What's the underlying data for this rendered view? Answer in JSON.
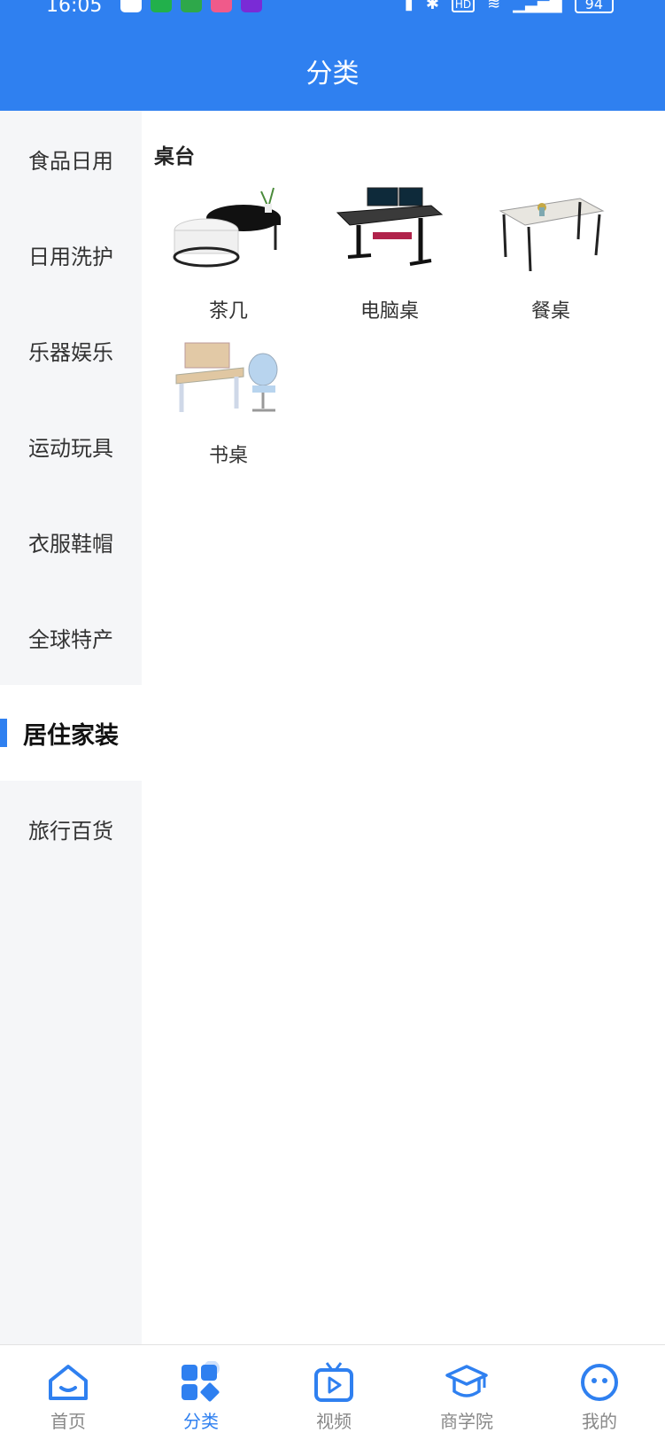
{
  "status_bar": {
    "time": "16:05",
    "hd_label": "HD",
    "battery": "94"
  },
  "header": {
    "title": "分类"
  },
  "sidebar": {
    "items": [
      {
        "label": "食品日用"
      },
      {
        "label": "日用洗护"
      },
      {
        "label": "乐器娱乐"
      },
      {
        "label": "运动玩具"
      },
      {
        "label": "衣服鞋帽"
      },
      {
        "label": "全球特产"
      },
      {
        "label": "居住家装",
        "active": true
      },
      {
        "label": "旅行百货"
      }
    ]
  },
  "content": {
    "section_title": "桌台",
    "products": [
      {
        "name": "茶几",
        "icon": "coffee-table-image"
      },
      {
        "name": "电脑桌",
        "icon": "computer-desk-image"
      },
      {
        "name": "餐桌",
        "icon": "dining-table-image"
      },
      {
        "name": "书桌",
        "icon": "study-desk-image"
      }
    ]
  },
  "tabbar": {
    "items": [
      {
        "label": "首页",
        "icon": "home-icon"
      },
      {
        "label": "分类",
        "icon": "category-icon",
        "active": true
      },
      {
        "label": "视频",
        "icon": "video-icon"
      },
      {
        "label": "商学院",
        "icon": "academy-icon"
      },
      {
        "label": "我的",
        "icon": "profile-icon"
      }
    ]
  },
  "colors": {
    "accent": "#2f80f0",
    "sidebar_bg": "#f5f6f8"
  }
}
